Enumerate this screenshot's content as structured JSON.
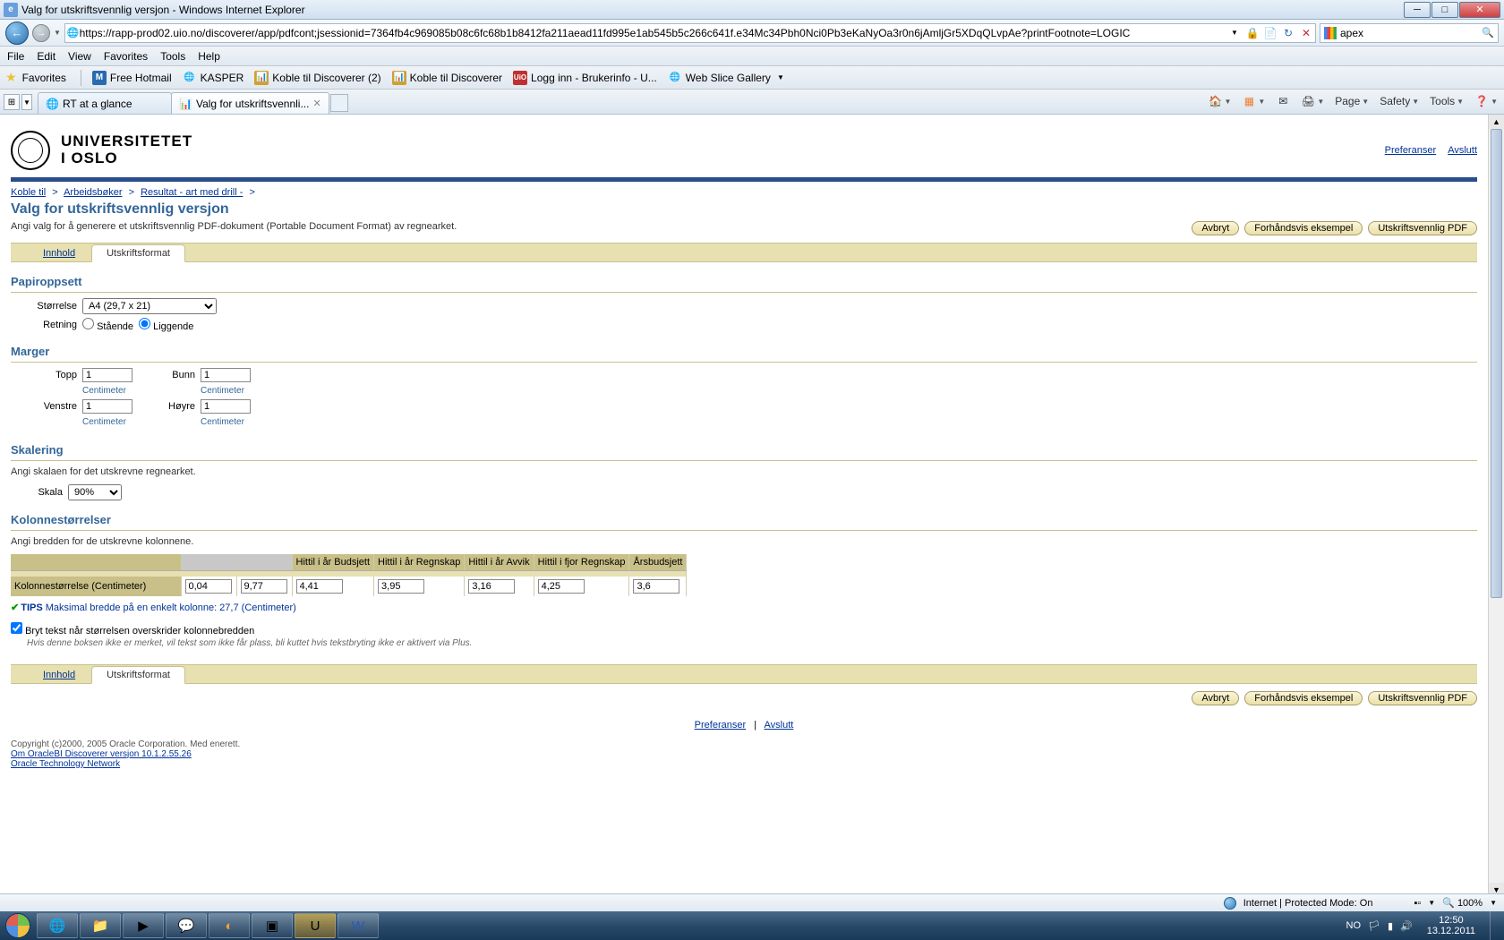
{
  "window": {
    "title": "Valg for utskriftsvennlig versjon - Windows Internet Explorer"
  },
  "nav": {
    "url": "https://rapp-prod02.uio.no/discoverer/app/pdfcont;jsessionid=7364fb4c969085b08c6fc68b1b8412fa211aead11fd995e1ab545b5c266c641f.e34Mc34Pbh0Nci0Pb3eKaNyOa3r0n6jAmljGr5XDqQLvpAe?printFootnote=LOGIC",
    "search": "apex"
  },
  "menu": {
    "file": "File",
    "edit": "Edit",
    "view": "View",
    "favorites": "Favorites",
    "tools": "Tools",
    "help": "Help"
  },
  "favbar": {
    "label": "Favorites",
    "items": [
      "Free Hotmail",
      "KASPER",
      "Koble til Discoverer (2)",
      "Koble til Discoverer",
      "Logg inn - Brukerinfo - U...",
      "Web Slice Gallery"
    ]
  },
  "tabs": {
    "t1": "RT at a glance",
    "t2": "Valg for utskriftsvennli..."
  },
  "toolbar_right": {
    "page": "Page",
    "safety": "Safety",
    "tools": "Tools"
  },
  "uio": {
    "line1": "UNIVERSITETET",
    "line2": "I OSLO",
    "pref": "Preferanser",
    "exit": "Avslutt"
  },
  "crumbs": {
    "c1": "Koble til",
    "c2": "Arbeidsbøker",
    "c3": "Resultat - art med drill -",
    "sep": ">"
  },
  "page": {
    "title": "Valg for utskriftsvennlig versjon",
    "desc": "Angi valg for å generere et utskriftsvennlig PDF-dokument (Portable Document Format) av regnearket."
  },
  "actions": {
    "cancel": "Avbryt",
    "preview": "Forhåndsvis eksempel",
    "pdf": "Utskriftsvennlig PDF"
  },
  "tabset": {
    "content": "Innhold",
    "format": "Utskriftsformat"
  },
  "paper": {
    "title": "Papiroppsett",
    "size_label": "Størrelse",
    "size_value": "A4 (29,7 x 21)",
    "orient_label": "Retning",
    "portrait": "Stående",
    "landscape": "Liggende"
  },
  "margins": {
    "title": "Marger",
    "top": "Topp",
    "bottom": "Bunn",
    "left": "Venstre",
    "right": "Høyre",
    "val_top": "1",
    "val_bottom": "1",
    "val_left": "1",
    "val_right": "1",
    "unit": "Centimeter"
  },
  "scale": {
    "title": "Skalering",
    "desc": "Angi skalaen for det utskrevne regnearket.",
    "label": "Skala",
    "value": "90%"
  },
  "cols": {
    "title": "Kolonnestørrelser",
    "desc": "Angi bredden for de utskrevne kolonnene.",
    "headers": [
      "Hittil i år Budsjett",
      "Hittil i år Regnskap",
      "Hittil i år Avvik",
      "Hittil i fjor Regnskap",
      "Årsbudsjett"
    ],
    "rowlabel": "Kolonnestørrelse (Centimeter)",
    "values": [
      "0,04",
      "9,77",
      "4,41",
      "3,95",
      "3,16",
      "4,25",
      "3,6"
    ],
    "tip_prefix": "TIPS",
    "tip": "Maksimal bredde på en enkelt kolonne: 27,7 (Centimeter)",
    "wrap": "Bryt tekst når størrelsen overskrider kolonnebredden",
    "wrap_note": "Hvis denne boksen ikke er merket, vil tekst som ikke får plass, bli kuttet hvis tekstbryting ikke er aktivert via Plus."
  },
  "footer": {
    "pref": "Preferanser",
    "exit": "Avslutt",
    "copyright": "Copyright (c)2000, 2005 Oracle Corporation. Med enerett.",
    "link1": "Om OracleBI Discoverer versjon 10.1.2.55.26",
    "link2": "Oracle Technology Network"
  },
  "status": {
    "zone": "Internet | Protected Mode: On",
    "zoom": "100%"
  },
  "tray": {
    "lang": "NO",
    "time": "12:50",
    "date": "13.12.2011"
  }
}
